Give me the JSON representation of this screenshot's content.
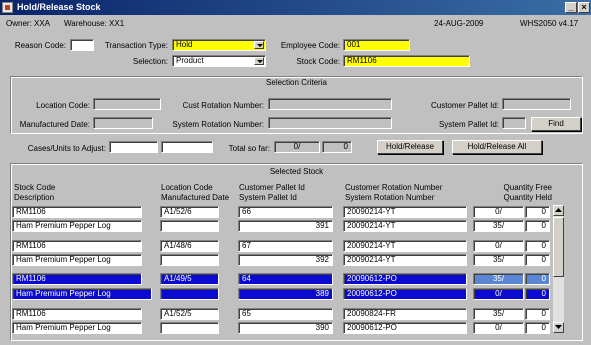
{
  "window": {
    "title": "Hold/Release Stock",
    "minimize": "_",
    "close": "×"
  },
  "info": {
    "owner": "Owner: XXA",
    "warehouse": "Warehouse: XX1",
    "date": "24-AUG-2009",
    "version": "WHS2050  v4.17"
  },
  "form": {
    "reason_code_label": "Reason Code:",
    "reason_code": "",
    "transaction_type_label": "Transaction Type:",
    "transaction_type": "Hold",
    "employee_code_label": "Employee Code:",
    "employee_code": "001",
    "selection_label": "Selection:",
    "selection": "Product",
    "stock_code_label": "Stock Code:",
    "stock_code": "RM1106"
  },
  "criteria": {
    "title": "Selection Criteria",
    "location_code_label": "Location Code:",
    "cust_rotation_label": "Cust Rotation Number:",
    "customer_pallet_label": "Customer Pallet Id:",
    "manufactured_date_label": "Manufactured Date:",
    "system_rotation_label": "System Rotation Number:",
    "system_pallet_label": "System Pallet Id:",
    "find_label": "Find"
  },
  "adjust": {
    "cases_label": "Cases/Units to Adjust:",
    "total_label": "Total so far:",
    "total_a": "0/",
    "total_b": "0",
    "hold_release_label": "Hold/Release",
    "hold_release_all_label": "Hold/Release All"
  },
  "stock": {
    "title": "Selected Stock",
    "headers": {
      "stock_code": "Stock Code",
      "description": "Description",
      "location_code": "Location Code",
      "manufactured_date": "Manufactured Date",
      "customer_pallet": "Customer Pallet Id",
      "system_pallet": "System Pallet Id",
      "customer_rotation": "Customer Rotation Number",
      "system_rotation": "System Rotation Number",
      "qty_free": "Quantity Free",
      "qty_held": "Quantity Held"
    },
    "rows": [
      {
        "stock_code": "RM1106",
        "description": "Ham Premium Pepper Log",
        "location": "A1/52/6",
        "mfg_date": "",
        "cust_pallet": "66",
        "sys_pallet": "391",
        "cust_rotation": "20090214-YT",
        "sys_rotation": "20090214-YT",
        "free_a": "0/",
        "free_b": "0",
        "held_a": "35/",
        "held_b": "0"
      },
      {
        "stock_code": "RM1106",
        "description": "Ham Premium Pepper Log",
        "location": "A1/48/6",
        "mfg_date": "",
        "cust_pallet": "67",
        "sys_pallet": "392",
        "cust_rotation": "20090214-YT",
        "sys_rotation": "20090214-YT",
        "free_a": "0/",
        "free_b": "0",
        "held_a": "35/",
        "held_b": "0"
      },
      {
        "stock_code": "RM1106",
        "description": "Ham Premium Pepper Log",
        "location": "A1/49/5",
        "mfg_date": "",
        "cust_pallet": "64",
        "sys_pallet": "389",
        "cust_rotation": "20090612-PO",
        "sys_rotation": "20090612-PO",
        "free_a": "35/",
        "free_b": "0",
        "held_a": "0/",
        "held_b": "0"
      },
      {
        "stock_code": "RM1106",
        "description": "Ham Premium Pepper Log",
        "location": "A1/52/5",
        "mfg_date": "",
        "cust_pallet": "65",
        "sys_pallet": "390",
        "cust_rotation": "20090824-FR",
        "sys_rotation": "20090612-PO",
        "free_a": "35/",
        "free_b": "0",
        "held_a": "0/",
        "held_b": "0"
      }
    ]
  }
}
